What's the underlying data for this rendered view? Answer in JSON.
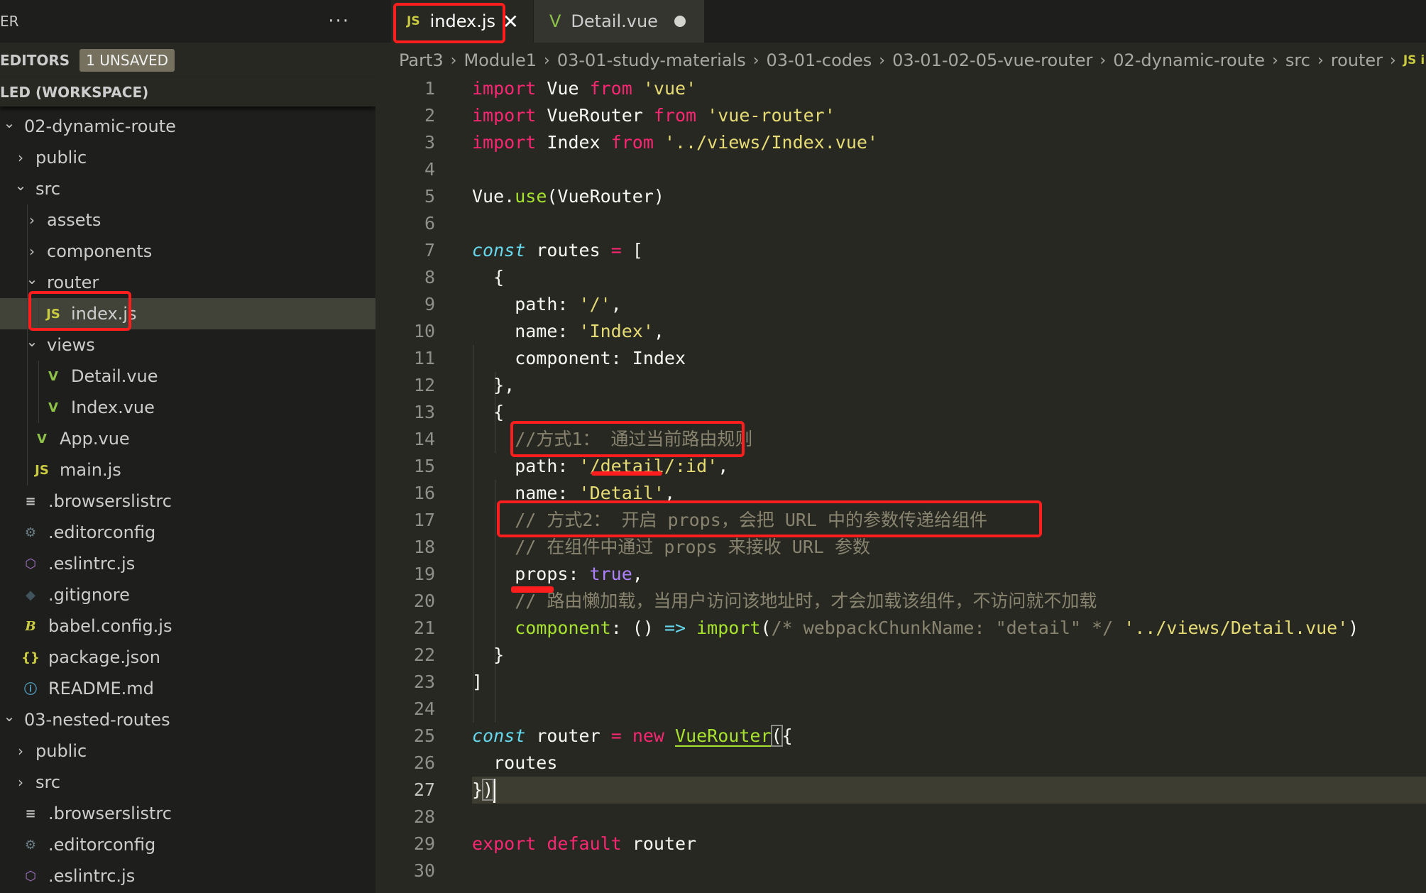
{
  "sidebar": {
    "title": "ER",
    "more_label": "···",
    "open_editors": {
      "label": "EDITORS",
      "badge": "1 UNSAVED"
    },
    "workspace": {
      "label": "LED (WORKSPACE)"
    },
    "tree": [
      {
        "label": "02-dynamic-route",
        "type": "folder",
        "expanded": true,
        "depth": 0
      },
      {
        "label": "public",
        "type": "folder",
        "expanded": false,
        "depth": 1
      },
      {
        "label": "src",
        "type": "folder",
        "expanded": true,
        "depth": 1
      },
      {
        "label": "assets",
        "type": "folder",
        "expanded": false,
        "depth": 2
      },
      {
        "label": "components",
        "type": "folder",
        "expanded": false,
        "depth": 2
      },
      {
        "label": "router",
        "type": "folder",
        "expanded": true,
        "depth": 2
      },
      {
        "label": "index.js",
        "type": "js",
        "depth": 3,
        "active": true
      },
      {
        "label": "views",
        "type": "folder",
        "expanded": true,
        "depth": 2
      },
      {
        "label": "Detail.vue",
        "type": "vue",
        "depth": 3
      },
      {
        "label": "Index.vue",
        "type": "vue",
        "depth": 3
      },
      {
        "label": "App.vue",
        "type": "vue",
        "depth": 2
      },
      {
        "label": "main.js",
        "type": "js",
        "depth": 2
      },
      {
        "label": ".browserslistrc",
        "type": "lines",
        "depth": 1
      },
      {
        "label": ".editorconfig",
        "type": "gear",
        "depth": 1
      },
      {
        "label": ".eslintrc.js",
        "type": "eslint",
        "depth": 1
      },
      {
        "label": ".gitignore",
        "type": "git",
        "depth": 1
      },
      {
        "label": "babel.config.js",
        "type": "babel",
        "depth": 1
      },
      {
        "label": "package.json",
        "type": "json",
        "depth": 1
      },
      {
        "label": "README.md",
        "type": "info",
        "depth": 1
      },
      {
        "label": "03-nested-routes",
        "type": "folder",
        "expanded": true,
        "depth": 0
      },
      {
        "label": "public",
        "type": "folder",
        "expanded": false,
        "depth": 1
      },
      {
        "label": "src",
        "type": "folder",
        "expanded": false,
        "depth": 1
      },
      {
        "label": ".browserslistrc",
        "type": "lines",
        "depth": 1
      },
      {
        "label": ".editorconfig",
        "type": "gear",
        "depth": 1
      },
      {
        "label": ".eslintrc.js",
        "type": "eslint",
        "depth": 1
      }
    ]
  },
  "icons": {
    "js": "JS",
    "vue": "V",
    "lines": "≡",
    "gear": "⚙",
    "eslint": "⬡",
    "git": "◆",
    "babel": "B",
    "json": "{}",
    "info": "ⓘ",
    "chevron_down": "⌄",
    "chevron_right": "›",
    "close": "✕"
  },
  "tabs": [
    {
      "label": "index.js",
      "icon": "js",
      "active": true,
      "state": "close"
    },
    {
      "label": "Detail.vue",
      "icon": "vue",
      "active": false,
      "state": "unsaved-dot"
    }
  ],
  "breadcrumb": [
    "Part3",
    "Module1",
    "03-01-study-materials",
    "03-01-codes",
    "03-01-02-05-vue-router",
    "02-dynamic-route",
    "src",
    "router",
    "JS i"
  ],
  "editor": {
    "current_line": 27,
    "lines": [
      [
        [
          "kw",
          "import"
        ],
        [
          "pl",
          " Vue "
        ],
        [
          "kw",
          "from"
        ],
        [
          "pl",
          " "
        ],
        [
          "st",
          "'vue'"
        ]
      ],
      [
        [
          "kw",
          "import"
        ],
        [
          "pl",
          " VueRouter "
        ],
        [
          "kw",
          "from"
        ],
        [
          "pl",
          " "
        ],
        [
          "st",
          "'vue-router'"
        ]
      ],
      [
        [
          "kw",
          "import"
        ],
        [
          "pl",
          " Index "
        ],
        [
          "kw",
          "from"
        ],
        [
          "pl",
          " "
        ],
        [
          "st",
          "'../views/Index.vue'"
        ]
      ],
      [],
      [
        [
          "pl",
          "Vue."
        ],
        [
          "fn",
          "use"
        ],
        [
          "pl",
          "(VueRouter)"
        ]
      ],
      [],
      [
        [
          "sk",
          "const"
        ],
        [
          "pl",
          " routes "
        ],
        [
          "kw",
          "="
        ],
        [
          "pl",
          " ["
        ]
      ],
      [
        [
          "pl",
          "  {"
        ]
      ],
      [
        [
          "pl",
          "    path: "
        ],
        [
          "st",
          "'/'"
        ],
        [
          "pl",
          ","
        ]
      ],
      [
        [
          "pl",
          "    name: "
        ],
        [
          "st",
          "'Index'"
        ],
        [
          "pl",
          ","
        ]
      ],
      [
        [
          "pl",
          "    component: Index"
        ]
      ],
      [
        [
          "pl",
          "  },"
        ]
      ],
      [
        [
          "pl",
          "  {"
        ]
      ],
      [
        [
          "pl",
          "    "
        ],
        [
          "cm",
          "//方式1： 通过当前路由规则"
        ]
      ],
      [
        [
          "pl",
          "    path: "
        ],
        [
          "st",
          "'/detail/:id'"
        ],
        [
          "pl",
          ","
        ]
      ],
      [
        [
          "pl",
          "    name: "
        ],
        [
          "st",
          "'Detail'"
        ],
        [
          "pl",
          ","
        ]
      ],
      [
        [
          "pl",
          "    "
        ],
        [
          "cm",
          "// 方式2： 开启 props，会把 URL 中的参数传递给组件"
        ]
      ],
      [
        [
          "pl",
          "    "
        ],
        [
          "cm",
          "// 在组件中通过 props 来接收 URL 参数"
        ]
      ],
      [
        [
          "pl",
          "    props: "
        ],
        [
          "bo",
          "true"
        ],
        [
          "pl",
          ","
        ]
      ],
      [
        [
          "pl",
          "    "
        ],
        [
          "cm",
          "// 路由懒加载，当用户访问该地址时，才会加载该组件，不访问就不加载"
        ]
      ],
      [
        [
          "pl",
          "    "
        ],
        [
          "fn",
          "component"
        ],
        [
          "pl",
          ": () "
        ],
        [
          "sk-n",
          "=>"
        ],
        [
          "pl",
          " "
        ],
        [
          "fn",
          "import"
        ],
        [
          "pl",
          "("
        ],
        [
          "cm",
          "/* webpackChunkName: \"detail\" */"
        ],
        [
          "pl",
          " "
        ],
        [
          "st",
          "'../views/Detail.vue'"
        ],
        [
          "pl",
          ")"
        ]
      ],
      [
        [
          "pl",
          "  }"
        ]
      ],
      [
        [
          "pl",
          "]"
        ]
      ],
      [],
      [
        [
          "sk",
          "const"
        ],
        [
          "pl",
          " router "
        ],
        [
          "kw",
          "="
        ],
        [
          "pl",
          " "
        ],
        [
          "kw",
          "new"
        ],
        [
          "pl",
          " "
        ],
        [
          "fn-ul",
          "VueRouter"
        ],
        [
          "brk",
          "("
        ],
        [
          "pl",
          "{"
        ]
      ],
      [
        [
          "pl",
          "  routes"
        ]
      ],
      [
        [
          "pl",
          "}"
        ],
        [
          "brk",
          ")"
        ],
        [
          "cursor",
          ""
        ]
      ],
      [],
      [
        [
          "kw",
          "export"
        ],
        [
          "pl",
          " "
        ],
        [
          "kw",
          "default"
        ],
        [
          "pl",
          " router"
        ]
      ],
      []
    ]
  },
  "colors": {
    "annotation_red": "#ff1e1e",
    "keyword": "#f92672",
    "string": "#e6db74",
    "function": "#a6e22e",
    "storage": "#66d9ef",
    "comment": "#88846f",
    "boolean": "#ae81ff"
  }
}
